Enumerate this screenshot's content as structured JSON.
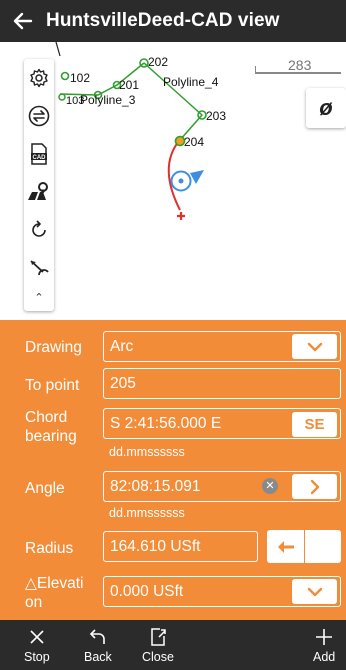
{
  "header": {
    "title": "HuntsvilleDeed-CAD view",
    "back_icon": "arrow-left-icon"
  },
  "map": {
    "scale_label": "283",
    "points": [
      {
        "label": "102"
      },
      {
        "label": "103"
      },
      {
        "label": "201"
      },
      {
        "label": "202"
      },
      {
        "label": "203"
      },
      {
        "label": "204"
      }
    ],
    "polylines": [
      "Polyline_3",
      "Polyline_4"
    ],
    "phi_button": "ø"
  },
  "toolbar": {
    "items": [
      "gear-icon",
      "swap-icon",
      "cad-icon",
      "map-pin-icon",
      "refresh-icon",
      "measure-icon",
      "collapse-icon"
    ]
  },
  "form": {
    "drawing": {
      "label": "Drawing",
      "value": "Arc"
    },
    "to_point": {
      "label": "To point",
      "value": "205"
    },
    "chord_bearing": {
      "label_line1": "Chord",
      "label_line2": "bearing",
      "value": "S 2:41:56.000 E",
      "button": "SE",
      "hint": "dd.mmssssss"
    },
    "angle": {
      "label": "Angle",
      "value": "82:08:15.091",
      "hint": "dd.mmssssss"
    },
    "radius": {
      "label": "Radius",
      "value": "164.610 USft"
    },
    "elevation": {
      "label_line1": "△Elevati",
      "label_line2": "on",
      "value": "0.000 USft"
    }
  },
  "bottom": {
    "stop": "Stop",
    "back": "Back",
    "close": "Close",
    "add": "Add"
  },
  "colors": {
    "accent": "#f28c38",
    "bar": "#2b2b2b",
    "arc": "#e0302a",
    "point": "#2e9e2e"
  }
}
